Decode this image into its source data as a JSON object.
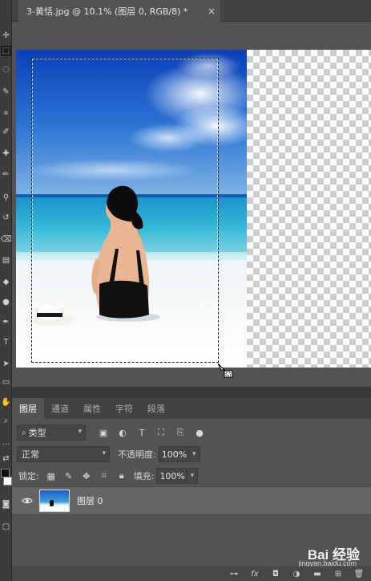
{
  "document": {
    "tab_title": "3-黄恬.jpg @ 10.1% (图层 0, RGB/8) *",
    "close_glyph": "×"
  },
  "panel": {
    "tabs": [
      {
        "label": "图层",
        "active": true
      },
      {
        "label": "通道",
        "active": false
      },
      {
        "label": "属性",
        "active": false
      },
      {
        "label": "字符",
        "active": false
      },
      {
        "label": "段落",
        "active": false
      }
    ],
    "filter": {
      "value": "类型"
    },
    "blend_mode": {
      "value": "正常"
    },
    "opacity": {
      "label": "不透明度:",
      "value": "100%"
    },
    "lock": {
      "label": "锁定:"
    },
    "fill": {
      "label": "填充:",
      "value": "100%"
    },
    "layers": [
      {
        "name": "图层 0",
        "visible": true
      }
    ]
  },
  "watermark": {
    "main": "Bai 经验",
    "sub": "jingyan.baidu.com"
  },
  "colors": {
    "ui_bg": "#535353",
    "panel_dark": "#424242",
    "layer_selected": "#656565",
    "sky_blue": "#1f5cc8",
    "sea_turquoise": "#33b5d6"
  }
}
